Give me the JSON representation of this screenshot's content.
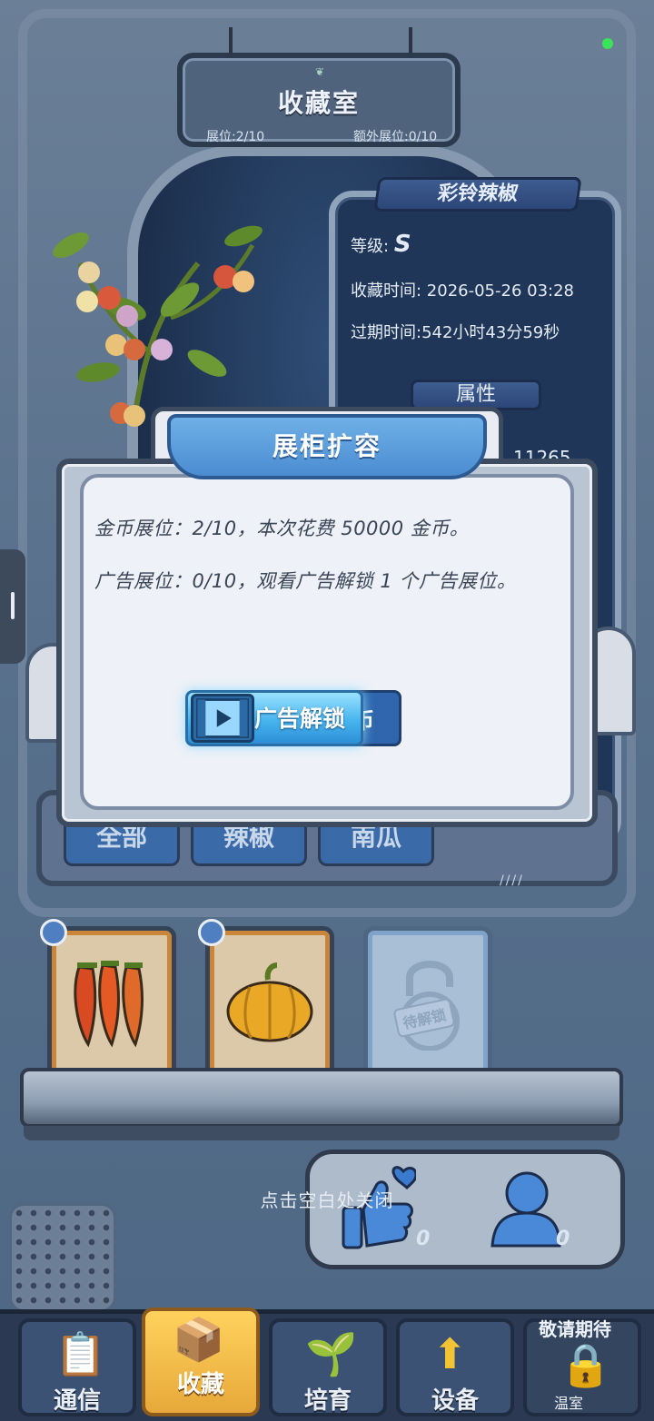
{
  "header": {
    "title": "收藏室",
    "slots": "展位:2/10",
    "extra_slots": "额外展位:0/10"
  },
  "item_info": {
    "name": "彩铃辣椒",
    "grade_label": "等级:",
    "grade_value": "S",
    "collect_time": "收藏时间: 2026-05-26 03:28",
    "expire_time": "过期时间:542小时43分59秒",
    "attributes_label": "属性",
    "attribute_value": "11265"
  },
  "categories": [
    "全部",
    "辣椒",
    "南瓜"
  ],
  "shelf": {
    "unlock_label": "待解锁"
  },
  "likes": {
    "thumbs_count": "0",
    "follow_count": "0"
  },
  "close_hint": "点击空白处关闭",
  "nav": {
    "items": [
      "通信",
      "收藏",
      "培育",
      "设备",
      "温室"
    ],
    "active": "收藏",
    "coming_soon": "敬请期待"
  },
  "modal": {
    "title": "展柜扩容",
    "coin_line": "金币展位：2/10，本次花费 50000 金币。",
    "ad_line": "广告展位：0/10，观看广告解锁 1 个广告展位。",
    "ad_button": "广告解锁",
    "coin_button_partial": "币"
  },
  "colors": {
    "modal_header": "#4a8cd0",
    "ad_button": "#47b4ee",
    "nav_active": "#e6a83a",
    "status_dot": "#3be35a"
  }
}
